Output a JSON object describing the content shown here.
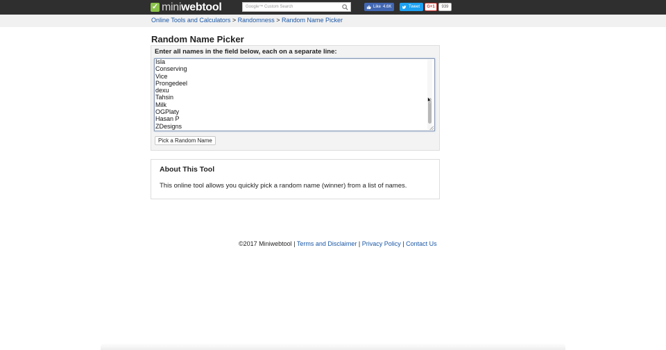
{
  "header": {
    "logo_part1": "mini",
    "logo_part2": "webtool",
    "search_placeholder": "Google™ Custom Search",
    "fb_like_label": "Like",
    "fb_like_count": "4.6K",
    "tweet_label": "Tweet",
    "gplus_label": "G+1",
    "gplus_count": "939"
  },
  "breadcrumb": {
    "item1": "Online Tools and Calculators",
    "sep1": " > ",
    "item2": "Randomness",
    "sep2": " > ",
    "item3": "Random Name Picker"
  },
  "page_title": "Random Name Picker",
  "form": {
    "label": "Enter all names in the field below, each on a separate line:",
    "names": [
      "Isla",
      "Conserving",
      "Vice",
      "Prongedeel",
      "dexu",
      "Tahsin",
      "Milk",
      "OGPlaty",
      "Hasan P",
      "ZDesigns"
    ],
    "button_label": "Pick a Random Name"
  },
  "about": {
    "title": "About This Tool",
    "text": "This online tool allows you quickly pick a random name (winner) from a list of names."
  },
  "footer": {
    "copyright": "©2017 Miniwebtool",
    "sep": " | ",
    "terms": "Terms and Disclaimer",
    "privacy": "Privacy Policy",
    "contact": "Contact Us"
  },
  "colors": {
    "topbar": "#2f2f2f",
    "link": "#1a57a6",
    "logo_green": "#8bc34a",
    "facebook": "#4267b2",
    "twitter": "#1da1f2",
    "gplus": "#cc3732"
  }
}
